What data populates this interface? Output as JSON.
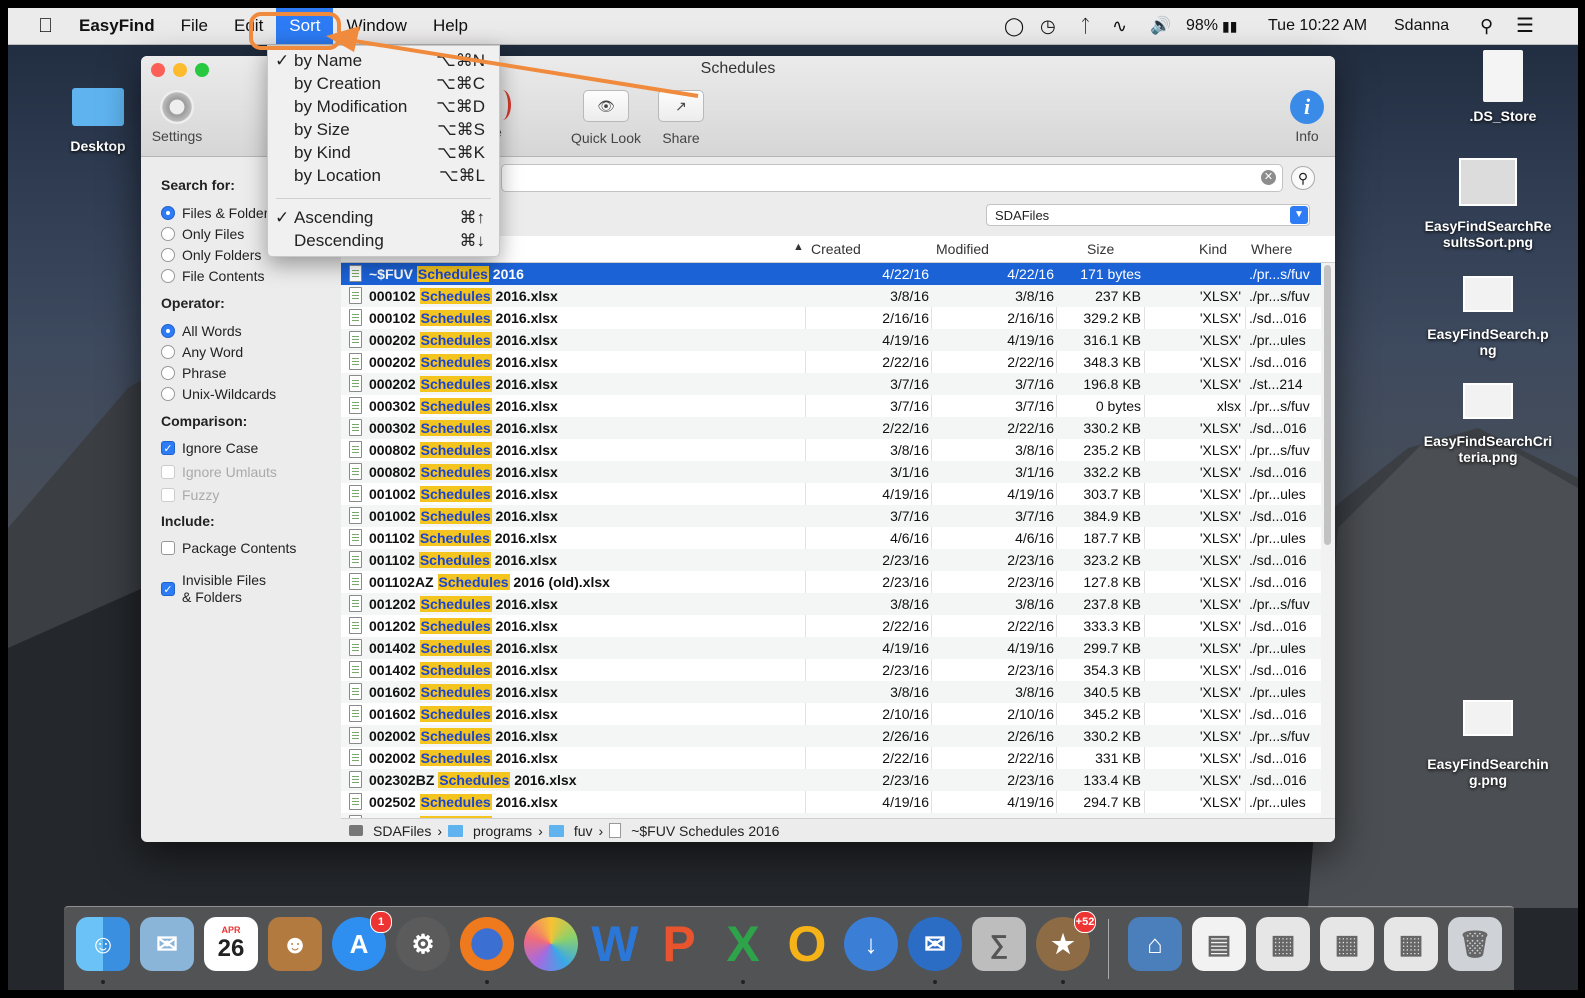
{
  "menubar": {
    "app": "EasyFind",
    "items": [
      "File",
      "Edit",
      "Sort",
      "Window",
      "Help"
    ],
    "active": "Sort",
    "battery": "98%",
    "clock": "Tue 10:22 AM",
    "user": "Sdanna"
  },
  "desktop": {
    "left_folder": "Desktop",
    "right_items": [
      "EasyFindSearchResultsSort.png",
      "EasyFindSearch.png",
      "EasyFindSearchCriteria.png",
      "EasyFindSearching.png"
    ],
    "ds_store": ".DS_Store",
    "ds_label": ".DS_Store",
    "results_sort_label": "EasyFindSearchRe sultsSort.png",
    "search_label": "EasyFindSearch.p ng",
    "criteria_label": "EasyFindSearchCri teria.png",
    "searching_label": "EasyFindSearchin g.png"
  },
  "window": {
    "title": "Schedules",
    "toolbar": {
      "settings": "Settings",
      "delete_partial": "te",
      "quick_look": "Quick Look",
      "share": "Share",
      "info": "Info"
    },
    "location": "SDAFiles"
  },
  "sort_menu": {
    "items": [
      {
        "label": "by Name",
        "shortcut": "⌥⌘N",
        "checked": true
      },
      {
        "label": "by Creation",
        "shortcut": "⌥⌘C",
        "checked": false
      },
      {
        "label": "by Modification",
        "shortcut": "⌥⌘D",
        "checked": false
      },
      {
        "label": "by Size",
        "shortcut": "⌥⌘S",
        "checked": false
      },
      {
        "label": "by Kind",
        "shortcut": "⌥⌘K",
        "checked": false
      },
      {
        "label": "by Location",
        "shortcut": "⌥⌘L",
        "checked": false
      }
    ],
    "order": [
      {
        "label": "Ascending",
        "shortcut": "⌘↑",
        "checked": true
      },
      {
        "label": "Descending",
        "shortcut": "⌘↓",
        "checked": false
      }
    ]
  },
  "sidebar": {
    "search_for": "Search for:",
    "search_options": [
      "Files & Folders",
      "Only Files",
      "Only Folders",
      "File Contents"
    ],
    "search_selected": 0,
    "operator": "Operator:",
    "operator_options": [
      "All Words",
      "Any Word",
      "Phrase",
      "Unix-Wildcards"
    ],
    "operator_selected": 0,
    "comparison": "Comparison:",
    "ignore_case": "Ignore Case",
    "ignore_umlauts": "Ignore Umlauts",
    "fuzzy": "Fuzzy",
    "include": "Include:",
    "package_contents": "Package Contents",
    "invisible_files_1": "Invisible Files",
    "invisible_files_2": "& Folders"
  },
  "table": {
    "columns": {
      "created": "Created",
      "modified": "Modified",
      "size": "Size",
      "kind": "Kind",
      "where": "Where"
    },
    "highlight_word": "Schedules",
    "rows": [
      {
        "pre": "~$FUV ",
        "post": " 2016",
        "created": "4/22/16",
        "modified": "4/22/16",
        "size": "171 bytes",
        "kind": "",
        "where": "./pr...s/fuv"
      },
      {
        "pre": "000102 ",
        "post": " 2016.xlsx",
        "created": "3/8/16",
        "modified": "3/8/16",
        "size": "237 KB",
        "kind": "'XLSX'",
        "where": "./pr...s/fuv"
      },
      {
        "pre": "000102 ",
        "post": " 2016.xlsx",
        "created": "2/16/16",
        "modified": "2/16/16",
        "size": "329.2 KB",
        "kind": "'XLSX'",
        "where": "./sd...016"
      },
      {
        "pre": "000202 ",
        "post": " 2016.xlsx",
        "created": "4/19/16",
        "modified": "4/19/16",
        "size": "316.1 KB",
        "kind": "'XLSX'",
        "where": "./pr...ules"
      },
      {
        "pre": "000202 ",
        "post": " 2016.xlsx",
        "created": "2/22/16",
        "modified": "2/22/16",
        "size": "348.3 KB",
        "kind": "'XLSX'",
        "where": "./sd...016"
      },
      {
        "pre": "000202 ",
        "post": " 2016.xlsx",
        "created": "3/7/16",
        "modified": "3/7/16",
        "size": "196.8 KB",
        "kind": "'XLSX'",
        "where": "./st...214"
      },
      {
        "pre": "000302 ",
        "post": " 2016.xlsx",
        "created": "3/7/16",
        "modified": "3/7/16",
        "size": "0 bytes",
        "kind": "xlsx",
        "where": "./pr...s/fuv"
      },
      {
        "pre": "000302 ",
        "post": " 2016.xlsx",
        "created": "2/22/16",
        "modified": "2/22/16",
        "size": "330.2 KB",
        "kind": "'XLSX'",
        "where": "./sd...016"
      },
      {
        "pre": "000802 ",
        "post": " 2016.xlsx",
        "created": "3/8/16",
        "modified": "3/8/16",
        "size": "235.2 KB",
        "kind": "'XLSX'",
        "where": "./pr...s/fuv"
      },
      {
        "pre": "000802 ",
        "post": " 2016.xlsx",
        "created": "3/1/16",
        "modified": "3/1/16",
        "size": "332.2 KB",
        "kind": "'XLSX'",
        "where": "./sd...016"
      },
      {
        "pre": "001002 ",
        "post": " 2016.xlsx",
        "created": "4/19/16",
        "modified": "4/19/16",
        "size": "303.7 KB",
        "kind": "'XLSX'",
        "where": "./pr...ules"
      },
      {
        "pre": "001002 ",
        "post": " 2016.xlsx",
        "created": "3/7/16",
        "modified": "3/7/16",
        "size": "384.9 KB",
        "kind": "'XLSX'",
        "where": "./sd...016"
      },
      {
        "pre": "001102 ",
        "post": " 2016.xlsx",
        "created": "4/6/16",
        "modified": "4/6/16",
        "size": "187.7 KB",
        "kind": "'XLSX'",
        "where": "./pr...ules"
      },
      {
        "pre": "001102 ",
        "post": " 2016.xlsx",
        "created": "2/23/16",
        "modified": "2/23/16",
        "size": "323.2 KB",
        "kind": "'XLSX'",
        "where": "./sd...016"
      },
      {
        "pre": "001102AZ ",
        "post": " 2016 (old).xlsx",
        "created": "2/23/16",
        "modified": "2/23/16",
        "size": "127.8 KB",
        "kind": "'XLSX'",
        "where": "./sd...016"
      },
      {
        "pre": "001202 ",
        "post": " 2016.xlsx",
        "created": "3/8/16",
        "modified": "3/8/16",
        "size": "237.8 KB",
        "kind": "'XLSX'",
        "where": "./pr...s/fuv"
      },
      {
        "pre": "001202 ",
        "post": " 2016.xlsx",
        "created": "2/22/16",
        "modified": "2/22/16",
        "size": "333.3 KB",
        "kind": "'XLSX'",
        "where": "./sd...016"
      },
      {
        "pre": "001402 ",
        "post": " 2016.xlsx",
        "created": "4/19/16",
        "modified": "4/19/16",
        "size": "299.7 KB",
        "kind": "'XLSX'",
        "where": "./pr...ules"
      },
      {
        "pre": "001402 ",
        "post": " 2016.xlsx",
        "created": "2/23/16",
        "modified": "2/23/16",
        "size": "354.3 KB",
        "kind": "'XLSX'",
        "where": "./sd...016"
      },
      {
        "pre": "001602 ",
        "post": " 2016.xlsx",
        "created": "3/8/16",
        "modified": "3/8/16",
        "size": "340.5 KB",
        "kind": "'XLSX'",
        "where": "./pr...ules"
      },
      {
        "pre": "001602 ",
        "post": " 2016.xlsx",
        "created": "2/10/16",
        "modified": "2/10/16",
        "size": "345.2 KB",
        "kind": "'XLSX'",
        "where": "./sd...016"
      },
      {
        "pre": "002002 ",
        "post": " 2016.xlsx",
        "created": "2/26/16",
        "modified": "2/26/16",
        "size": "330.2 KB",
        "kind": "'XLSX'",
        "where": "./pr...s/fuv"
      },
      {
        "pre": "002002 ",
        "post": " 2016.xlsx",
        "created": "2/22/16",
        "modified": "2/22/16",
        "size": "331 KB",
        "kind": "'XLSX'",
        "where": "./sd...016"
      },
      {
        "pre": "002302BZ ",
        "post": " 2016.xlsx",
        "created": "2/23/16",
        "modified": "2/23/16",
        "size": "133.4 KB",
        "kind": "'XLSX'",
        "where": "./sd...016"
      },
      {
        "pre": "002502 ",
        "post": " 2016.xlsx",
        "created": "4/19/16",
        "modified": "4/19/16",
        "size": "294.7 KB",
        "kind": "'XLSX'",
        "where": "./pr...ules"
      },
      {
        "pre": "002502 ",
        "post": " 2016.xlsx",
        "created": "2/22/16",
        "modified": "2/22/16",
        "size": "329.8 KB",
        "kind": "'XLSX'",
        "where": "./sd...016"
      }
    ]
  },
  "pathbar": [
    "SDAFiles",
    "programs",
    "fuv",
    "~$FUV Schedules 2016"
  ],
  "dock": {
    "calendar_month": "APR",
    "calendar_day": "26",
    "appstore_badge": "1",
    "misc_badge": "+52"
  },
  "colors": {
    "accent": "#2d7cf6",
    "highlight": "#f5c51f",
    "annotation": "#f08a3c"
  }
}
